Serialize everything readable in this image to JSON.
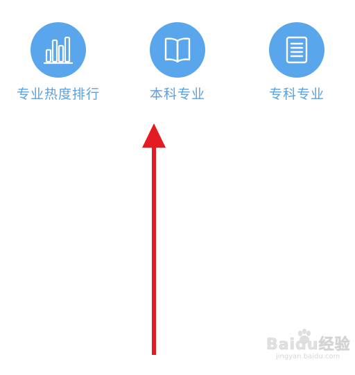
{
  "menu": {
    "items": [
      {
        "label": "专业热度排行",
        "icon": "bar-chart-icon"
      },
      {
        "label": "本科专业",
        "icon": "book-icon"
      },
      {
        "label": "专科专业",
        "icon": "document-icon"
      }
    ]
  },
  "colors": {
    "icon_background": "#5aa6ec",
    "label_text": "#5a9fe0",
    "arrow": "#e31c23",
    "page_background": "#ffffff"
  },
  "annotation": {
    "type": "arrow",
    "direction": "up"
  },
  "watermark": {
    "brand": "Baidu经验",
    "url": "jingyan.baidu.com"
  }
}
